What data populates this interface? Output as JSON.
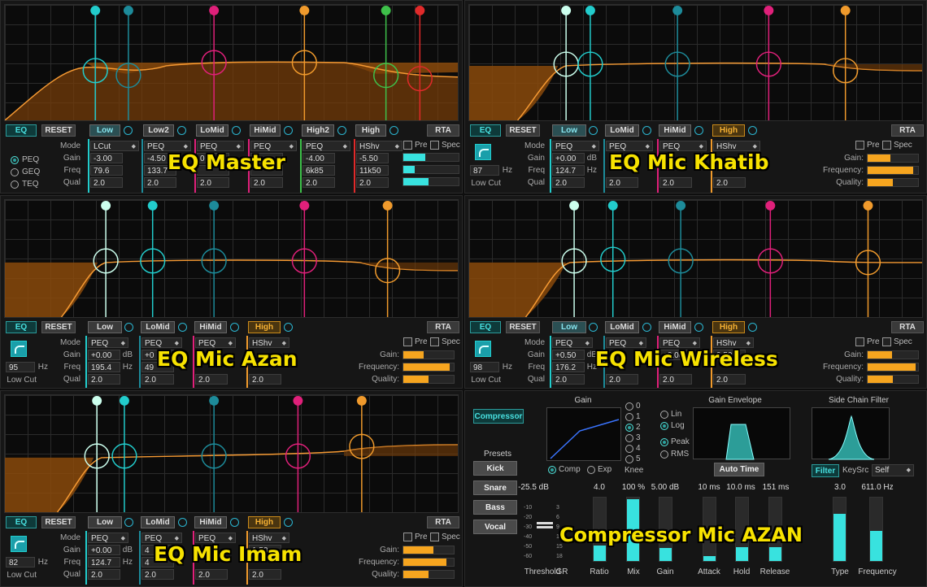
{
  "eq_common": {
    "eq": "EQ",
    "reset": "RESET",
    "rta": "RTA",
    "pre": "Pre",
    "spec": "Spec",
    "mode": "Mode",
    "gain": "Gain",
    "freq": "Freq",
    "qual": "Qual",
    "hz": "Hz",
    "db": "dB",
    "low_cut": "Low Cut",
    "gain_c": "Gain:",
    "frequency_c": "Frequency:",
    "quality_c": "Quality:"
  },
  "panels": {
    "master": {
      "title": "EQ Master",
      "bands": [
        "Low",
        "Low2",
        "LoMid",
        "HiMid",
        "High2",
        "High"
      ],
      "modes": [
        "LCut",
        "PEQ",
        "PEQ",
        "PEQ",
        "PEQ",
        "HShv"
      ],
      "gains": [
        "-3.00",
        "-4.50",
        "0",
        "0",
        "-4.00",
        "-5.50"
      ],
      "freqs": [
        "79.6",
        "133.7",
        "",
        "",
        "6k85",
        "11k50"
      ],
      "quals": [
        "2.0",
        "2.0",
        "2.0",
        "2.0",
        "2.0",
        "2.0"
      ],
      "radios": [
        "PEQ",
        "GEQ",
        "TEQ"
      ],
      "nodes": [
        "1",
        "2",
        "3",
        "4",
        "5",
        "6"
      ]
    },
    "khatib": {
      "title": "EQ Mic Khatib",
      "bands": [
        "Low",
        "LoMid",
        "HiMid",
        "High"
      ],
      "lowcut_hz": "87",
      "modes": [
        "PEQ",
        "PEQ",
        "PEQ",
        "HShv"
      ],
      "gains": [
        "+0.00",
        "",
        "",
        ""
      ],
      "freqs": [
        "124.7",
        "",
        "",
        ""
      ],
      "quals": [
        "2.0",
        "2.0",
        "2.0",
        "2.0"
      ],
      "nodes": [
        "1",
        "2",
        "3",
        "4"
      ]
    },
    "azan": {
      "title": "EQ Mic Azan",
      "bands": [
        "Low",
        "LoMid",
        "HiMid",
        "High"
      ],
      "lowcut_hz": "95",
      "modes": [
        "PEQ",
        "PEQ",
        "PEQ",
        "HShv"
      ],
      "gains": [
        "+0.00",
        "+0",
        "",
        ""
      ],
      "freqs": [
        "195.4",
        "49",
        "",
        ""
      ],
      "quals": [
        "2.0",
        "2.0",
        "2.0",
        "2.0"
      ],
      "nodes": [
        "1",
        "2",
        "3",
        "4"
      ]
    },
    "wireless": {
      "title": "EQ Mic Wireless",
      "bands": [
        "Low",
        "LoMid",
        "HiMid",
        "High"
      ],
      "lowcut_hz": "98",
      "modes": [
        "PEQ",
        "PEQ",
        "PEQ",
        "HShv"
      ],
      "gains": [
        "+0.50",
        "+0.00",
        "",
        "0.50"
      ],
      "freqs": [
        "176.2",
        "",
        "",
        ""
      ],
      "quals": [
        "2.0",
        "2.0",
        "2.0",
        "2.0"
      ],
      "nodes": [
        "1",
        "2",
        "3",
        "4"
      ]
    },
    "imam": {
      "title": "EQ Mic Imam",
      "bands": [
        "Low",
        "LoMid",
        "HiMid",
        "High"
      ],
      "lowcut_hz": "82",
      "modes": [
        "PEQ",
        "PEQ",
        "PEQ",
        "HShv"
      ],
      "gains": [
        "+0.00",
        "4",
        "",
        "1.50"
      ],
      "freqs": [
        "124.7",
        "4",
        "",
        ""
      ],
      "quals": [
        "2.0",
        "2.0",
        "2.0",
        "2.0"
      ],
      "nodes": [
        "1",
        "2",
        "3",
        "4"
      ]
    }
  },
  "compressor": {
    "title": "Compressor Mic AZAN",
    "compressor_btn": "Compressor",
    "presets_label": "Presets",
    "presets": [
      "Kick",
      "Snare",
      "Bass",
      "Vocal"
    ],
    "gain_title": "Gain",
    "knee_options": [
      "0",
      "1",
      "2",
      "3",
      "4",
      "5"
    ],
    "knee_selected": "2",
    "knee_label": "Knee",
    "comp": "Comp",
    "exp": "Exp",
    "gain_env_title": "Gain Envelope",
    "lin": "Lin",
    "log": "Log",
    "peak": "Peak",
    "rms": "RMS",
    "auto_time": "Auto Time",
    "sidechain_title": "Side Chain Filter",
    "filter": "Filter",
    "keysrc": "KeySrc",
    "self": "Self",
    "values": [
      "-25.5 dB",
      "4.0",
      "100 %",
      "5.00 dB",
      "10 ms",
      "10.0 ms",
      "151 ms",
      "3.0",
      "611.0 Hz"
    ],
    "names": [
      "Threshold",
      "GR",
      "Ratio",
      "Mix",
      "Gain",
      "Attack",
      "Hold",
      "Release",
      "Type",
      "Frequency"
    ],
    "scale_left": [
      "-10",
      "-20",
      "-30",
      "-40",
      "-50",
      "-60"
    ],
    "scale_right": [
      "3",
      "6",
      "9",
      "12",
      "15",
      "18"
    ],
    "levels": {
      "ratio": 0.3,
      "mix": 1.0,
      "gain": 0.3,
      "attack": 0.1,
      "hold": 0.3,
      "release": 0.3,
      "type": 0.8,
      "frequency": 0.5
    },
    "accent": "#38e2df"
  }
}
